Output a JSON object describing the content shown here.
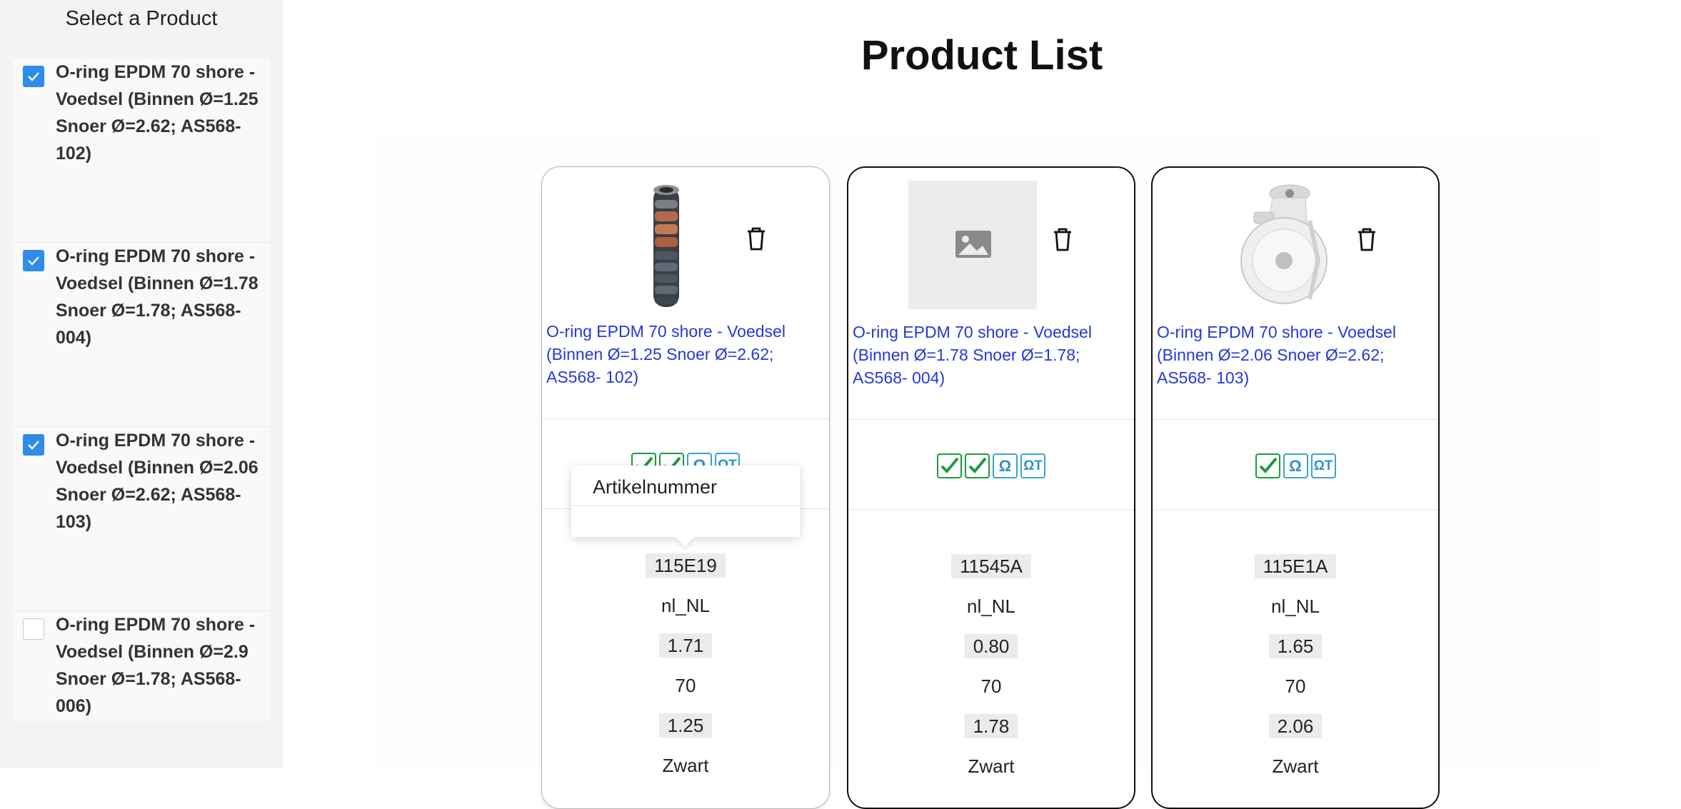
{
  "sidebar": {
    "title": "Select a Product",
    "items": [
      {
        "label": "O-ring EPDM 70 shore - Voedsel (Binnen Ø=1.25 Snoer Ø=2.62; AS568- 102)",
        "checked": true
      },
      {
        "label": "O-ring EPDM 70 shore - Voedsel (Binnen Ø=1.78 Snoer Ø=1.78; AS568- 004)",
        "checked": true
      },
      {
        "label": "O-ring EPDM 70 shore - Voedsel (Binnen Ø=2.06 Snoer Ø=2.62; AS568- 103)",
        "checked": true
      },
      {
        "label": "O-ring EPDM 70 shore - Voedsel (Binnen Ø=2.9 Snoer Ø=1.78; AS568- 006)",
        "checked": false
      }
    ]
  },
  "main": {
    "title": "Product List"
  },
  "tooltip": {
    "title": "Artikelnummer"
  },
  "products": [
    {
      "image": "orings-stack-photo",
      "link": "O-ring EPDM 70 shore - Voedsel (Binnen Ø=1.25 Snoer Ø=2.62; AS568- 102)",
      "certs": [
        "rohs",
        "rohs",
        "omega",
        "omegat"
      ],
      "article": "115E19",
      "locale": "nl_NL",
      "weight": "1.71",
      "hardness": "70",
      "inner_diameter": "1.25",
      "color": "Zwart"
    },
    {
      "image": "image-placeholder",
      "link": "O-ring EPDM 70 shore - Voedsel (Binnen Ø=1.78 Snoer Ø=1.78; AS568- 004)",
      "certs": [
        "rohs",
        "rohs",
        "omega",
        "omegat"
      ],
      "article": "11545A",
      "locale": "nl_NL",
      "weight": "0.80",
      "hardness": "70",
      "inner_diameter": "1.78",
      "color": "Zwart"
    },
    {
      "image": "caster-wheel-photo",
      "link": "O-ring EPDM 70 shore - Voedsel (Binnen Ø=2.06 Snoer Ø=2.62; AS568- 103)",
      "certs": [
        "rohs",
        "omega",
        "omegat"
      ],
      "article": "115E1A",
      "locale": "nl_NL",
      "weight": "1.65",
      "hardness": "70",
      "inner_diameter": "2.06",
      "color": "Zwart"
    }
  ],
  "colors": {
    "accent": "#2f8ce8",
    "link": "#2438d8",
    "rohs": "#1e9a3c",
    "omega": "#3aa3d4"
  }
}
